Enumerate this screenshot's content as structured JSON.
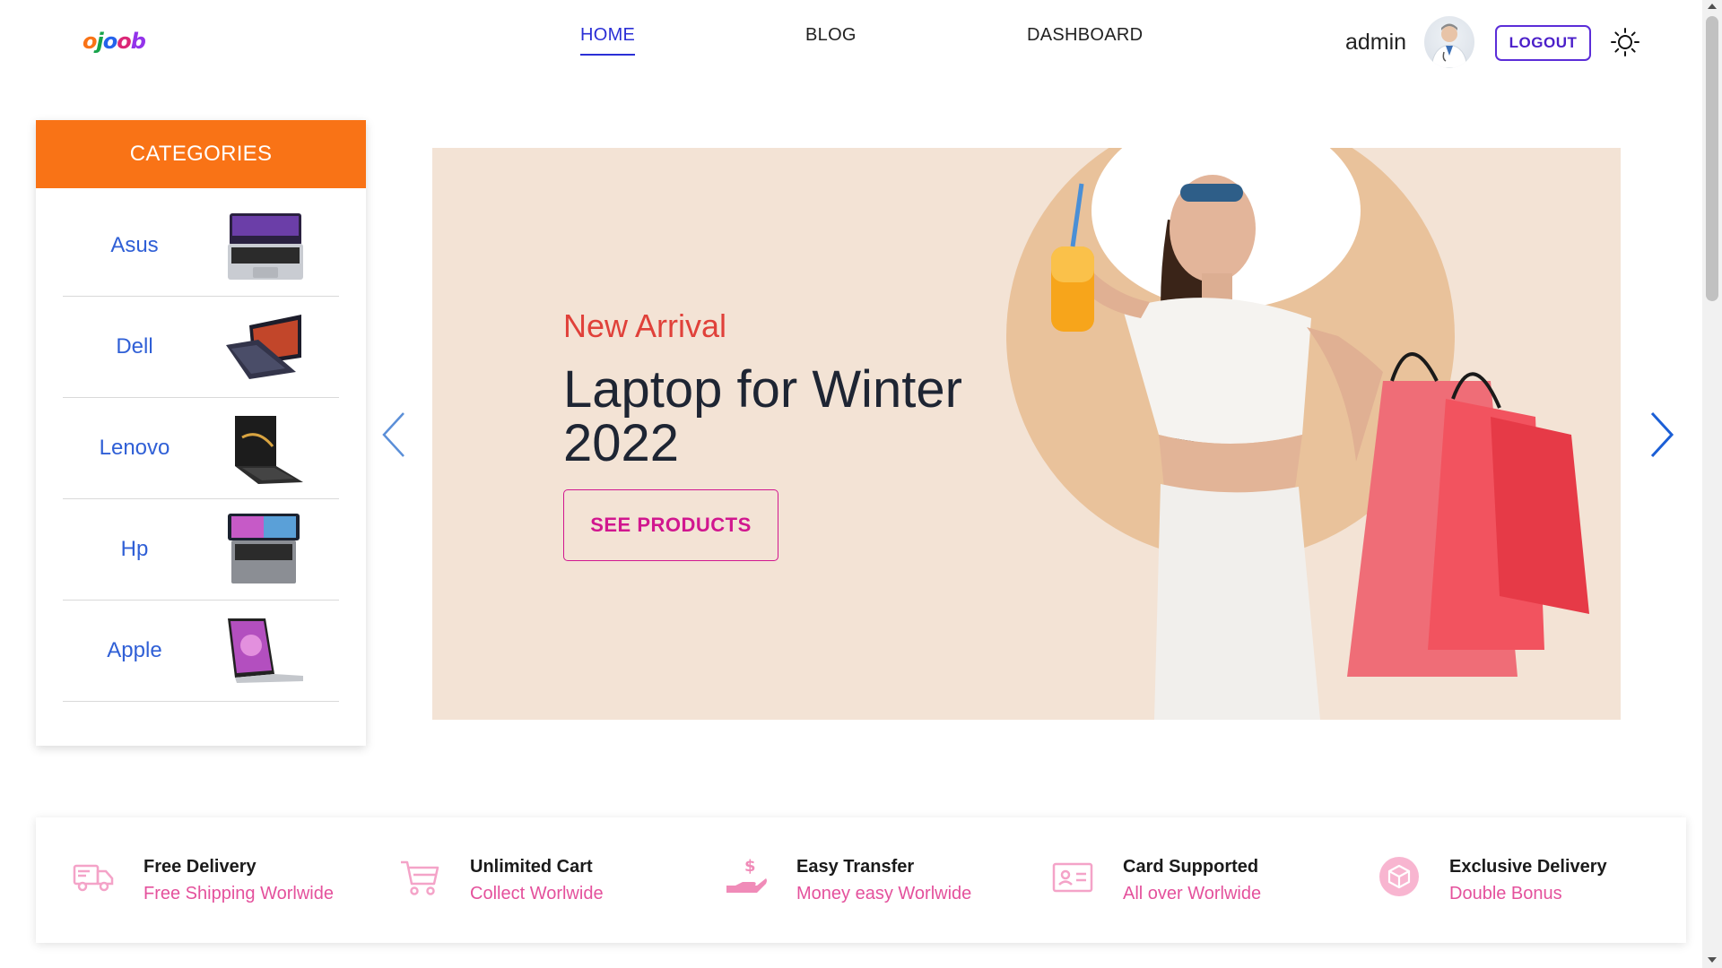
{
  "header": {
    "logo_letters": [
      "o",
      "j",
      "o",
      "o",
      "b"
    ],
    "logo_colors": [
      "#f97316",
      "#16a34a",
      "#2563eb",
      "#db2777",
      "#9333ea"
    ],
    "nav": [
      {
        "label": "HOME",
        "active": true
      },
      {
        "label": "BLOG",
        "active": false
      },
      {
        "label": "DASHBOARD",
        "active": false
      }
    ],
    "user_name": "admin",
    "logout_label": "LOGOUT",
    "theme_toggle_icon": "sun-icon"
  },
  "categories": {
    "title": "CATEGORIES",
    "header_color": "#f97316",
    "items": [
      {
        "label": "Asus",
        "icon": "laptop-thumbnail"
      },
      {
        "label": "Dell",
        "icon": "laptop-thumbnail"
      },
      {
        "label": "Lenovo",
        "icon": "laptop-thumbnail"
      },
      {
        "label": "Hp",
        "icon": "laptop-thumbnail"
      },
      {
        "label": "Apple",
        "icon": "laptop-thumbnail"
      }
    ]
  },
  "banner": {
    "subtitle": "New Arrival",
    "title": "Laptop for Winter 2022",
    "button_label": "SEE PRODUCTS",
    "background_color": "#f3e3d5",
    "prev_icon": "chevron-left-icon",
    "next_icon": "chevron-right-icon"
  },
  "features": [
    {
      "title": "Free Delivery",
      "subtitle": "Free Shipping Worlwide",
      "icon": "truck-icon"
    },
    {
      "title": "Unlimited Cart",
      "subtitle": "Collect Worlwide",
      "icon": "cart-icon"
    },
    {
      "title": "Easy Transfer",
      "subtitle": "Money easy Worlwide",
      "icon": "hand-money-icon"
    },
    {
      "title": "Card Supported",
      "subtitle": "All over Worlwide",
      "icon": "id-card-icon"
    },
    {
      "title": "Exclusive Delivery",
      "subtitle": "Double Bonus",
      "icon": "box-icon"
    }
  ],
  "colors": {
    "accent_blue": "#2b2fd6",
    "category_text": "#2f5fd6",
    "feature_pink": "#e4519c",
    "button_pink": "#d1178f",
    "subtitle_red": "#e0413a"
  }
}
